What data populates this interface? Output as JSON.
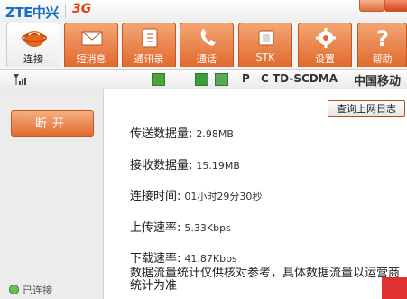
{
  "brand": {
    "name": "ZTE中兴",
    "mark": "3G"
  },
  "toolbar": {
    "tabs": [
      {
        "label": "连接",
        "icon": "globe-icon",
        "active": true
      },
      {
        "label": "短消息",
        "icon": "envelope-icon",
        "active": false
      },
      {
        "label": "通讯录",
        "icon": "address-book-icon",
        "active": false
      },
      {
        "label": "通话",
        "icon": "phone-handset-icon",
        "active": false
      },
      {
        "label": "STK",
        "icon": "sim-card-icon",
        "active": false
      },
      {
        "label": "设置",
        "icon": "gear-icon",
        "active": false
      },
      {
        "label": "帮助",
        "icon": "question-icon",
        "active": false
      }
    ]
  },
  "status_strip": {
    "pc": "P C",
    "network": "TD-SCDMA",
    "operator": "中国移动"
  },
  "left": {
    "disconnect_label": "断开",
    "connection_status": "已连接"
  },
  "main": {
    "log_button": "查询上网日志",
    "stats": [
      {
        "label": "传送数据量:",
        "value": "2.98MB"
      },
      {
        "label": "接收数据量:",
        "value": "15.19MB"
      },
      {
        "label": "连接时间:",
        "value": "01小时29分30秒"
      },
      {
        "label": "上传速率:",
        "value": "5.33Kbps"
      },
      {
        "label": "下载速率:",
        "value": "41.87Kbps"
      }
    ],
    "note": "数据流量统计仅供核对参考，具体数据流量以运营商统计为准"
  },
  "colors": {
    "accent": "#e06a2d",
    "brand_blue": "#1a6fc0"
  }
}
